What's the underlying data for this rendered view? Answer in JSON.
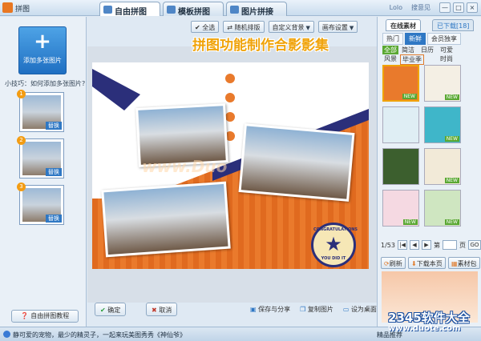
{
  "window": {
    "title": "拼图",
    "user": "Lolo",
    "user_action": "搜意见",
    "minimize": "—",
    "maximize": "□",
    "close": "×"
  },
  "tabs": [
    {
      "label": "自由拼图",
      "active": true
    },
    {
      "label": "模板拼图",
      "active": false
    },
    {
      "label": "图片拼接",
      "active": false
    }
  ],
  "left_panel": {
    "add_button": "添加多张图片",
    "add_symbol": "+",
    "tip": "小技巧：如何添加多张图片?",
    "thumbnails": [
      {
        "number": "1",
        "replace_label": "替换"
      },
      {
        "number": "2",
        "replace_label": "替换"
      },
      {
        "number": "3",
        "replace_label": "替换"
      }
    ],
    "tutorial_button": "自由拼图教程"
  },
  "toolbar": {
    "select_all": "全选",
    "random_layout": "随机排版",
    "custom_background": "自定义背景",
    "canvas_settings": "画布设置"
  },
  "promo_text": "拼图功能制作合影影集",
  "canvas": {
    "watermark": "www.Duo",
    "badge_top": "CONGRATULATIONS",
    "badge_bottom": "YOU DID IT",
    "badge_star": "★"
  },
  "actions": {
    "confirm": "确定",
    "confirm_icon": "✔",
    "cancel": "取消",
    "cancel_icon": "✖",
    "save_share": "保存与分享",
    "copy_image": "复制图片",
    "set_desktop": "设为桌面"
  },
  "right_panel": {
    "tabs": [
      {
        "label": "在线素材",
        "active": true
      },
      {
        "label": "已下载[18]",
        "active": false
      }
    ],
    "categories": [
      {
        "label": "热门",
        "active": false
      },
      {
        "label": "新鲜",
        "active": true
      },
      {
        "label": "会员独享",
        "active": false
      }
    ],
    "subcategories": [
      {
        "label": "全部",
        "style": "active"
      },
      {
        "label": "简洁",
        "style": ""
      },
      {
        "label": "日历",
        "style": ""
      },
      {
        "label": "可爱",
        "style": ""
      },
      {
        "label": "风景",
        "style": ""
      },
      {
        "label": "毕业季",
        "style": "hl"
      },
      {
        "label": "时尚",
        "style": ""
      }
    ],
    "templates": [
      {
        "new": "NEW",
        "selected": true,
        "color": "#e97a2c"
      },
      {
        "new": "NEW",
        "selected": false,
        "color": "#f4efe4"
      },
      {
        "new": "",
        "selected": false,
        "color": "#dfeef4"
      },
      {
        "new": "NEW",
        "selected": false,
        "color": "#3fb6c9"
      },
      {
        "new": "",
        "selected": false,
        "color": "#3c5f2e"
      },
      {
        "new": "NEW",
        "selected": false,
        "color": "#f2ead8"
      },
      {
        "new": "NEW",
        "selected": false,
        "color": "#f5d9e2"
      },
      {
        "new": "NEW",
        "selected": false,
        "color": "#cfe6c1"
      }
    ],
    "pager": {
      "page": "1/53",
      "first": "|◀",
      "prev": "◀",
      "next": "▶",
      "go_prefix": "第",
      "go_suffix": "页",
      "go": "GO"
    },
    "refresh": "刷新",
    "download_page": "下载本页",
    "material_package": "素材包"
  },
  "status": {
    "text": "静可爱的宠物，最少的精灵子，一起来玩美图秀秀《神仙爷》",
    "right": "精品推荐",
    "brand": "2345软件大全",
    "brand_url": "www.duote.com"
  }
}
